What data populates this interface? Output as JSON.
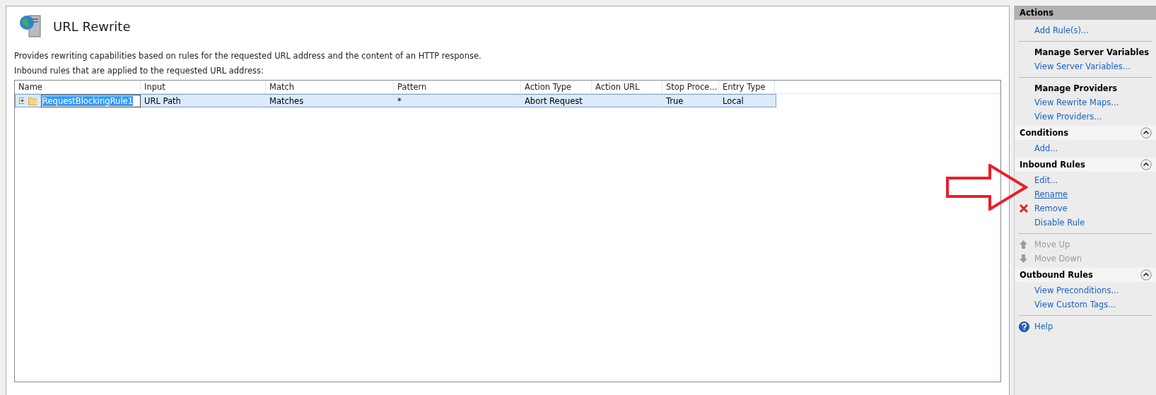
{
  "page": {
    "title": "URL Rewrite",
    "description": "Provides rewriting capabilities based on rules for the requested URL address and the content of an HTTP response.",
    "list_label": "Inbound rules that are applied to the requested URL address:"
  },
  "table": {
    "columns": [
      "Name",
      "Input",
      "Match",
      "Pattern",
      "Action Type",
      "Action URL",
      "Stop Proce...",
      "Entry Type"
    ],
    "rows": [
      {
        "cells": [
          "RequestBlockingRule1",
          "URL Path",
          "Matches",
          "*",
          "Abort Request",
          "",
          "True",
          "Local"
        ],
        "selected": true,
        "expanded": false,
        "editing": true
      }
    ]
  },
  "actions": {
    "title": "Actions",
    "items": [
      {
        "kind": "link",
        "label": "Add Rule(s)..."
      },
      {
        "kind": "separator"
      },
      {
        "kind": "heading",
        "label": "Manage Server Variables"
      },
      {
        "kind": "link",
        "label": "View Server Variables..."
      },
      {
        "kind": "separator"
      },
      {
        "kind": "heading",
        "label": "Manage Providers"
      },
      {
        "kind": "link",
        "label": "View Rewrite Maps..."
      },
      {
        "kind": "link",
        "label": "View Providers..."
      },
      {
        "kind": "group",
        "label": "Conditions",
        "expanded": true
      },
      {
        "kind": "link",
        "label": "Add..."
      },
      {
        "kind": "group",
        "label": "Inbound Rules",
        "expanded": true
      },
      {
        "kind": "link",
        "label": "Edit..."
      },
      {
        "kind": "link",
        "label": "Rename",
        "hovered": true
      },
      {
        "kind": "delete",
        "label": "Remove"
      },
      {
        "kind": "link",
        "label": "Disable Rule"
      },
      {
        "kind": "separator"
      },
      {
        "kind": "moveup",
        "label": "Move Up",
        "disabled": true
      },
      {
        "kind": "movedown",
        "label": "Move Down",
        "disabled": true
      },
      {
        "kind": "group",
        "label": "Outbound Rules",
        "expanded": true
      },
      {
        "kind": "link",
        "label": "View Preconditions..."
      },
      {
        "kind": "link",
        "label": "View Custom Tags..."
      },
      {
        "kind": "separator"
      },
      {
        "kind": "help",
        "label": "Help"
      }
    ]
  }
}
